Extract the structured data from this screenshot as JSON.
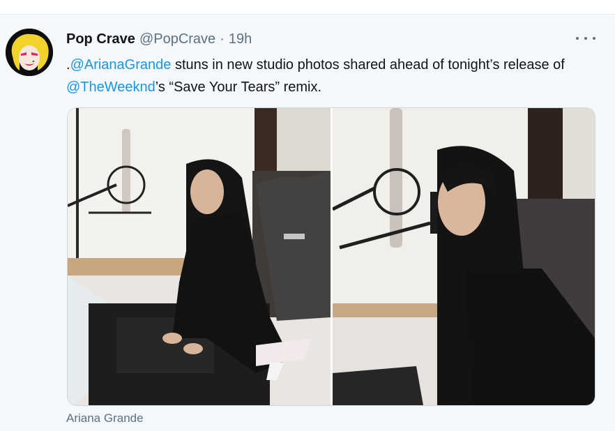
{
  "tweet": {
    "display_name": "Pop Crave",
    "handle": "@PopCrave",
    "separator": "·",
    "timestamp": "19h",
    "text": {
      "prefix": ".",
      "mention1": "@ArianaGrande",
      "middle": " stuns in new studio photos shared ahead of tonight’s release of ",
      "mention2": "@TheWeeknd",
      "suffix": "’s “Save Your Tears” remix."
    },
    "media_caption": "Ariana Grande"
  },
  "icons": {
    "more": "more-horizontal-icon"
  },
  "colors": {
    "link": "#1b95e0",
    "secondary_text": "#5b7083",
    "primary_text": "#0f1419",
    "background": "#f5f8fa"
  }
}
